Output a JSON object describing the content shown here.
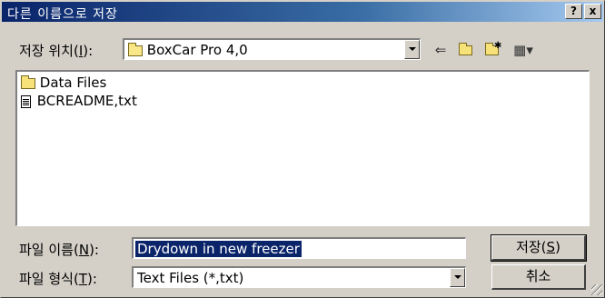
{
  "window": {
    "title": "다른 이름으로 저장",
    "help_label": "?",
    "close_label": "x"
  },
  "location": {
    "label": "저장 위치(",
    "accel": "I",
    "label_end": "):",
    "value": "BoxCar Pro 4,0"
  },
  "toolbar": {
    "back_icon": "back-arrow-icon",
    "up_icon": "up-folder-icon",
    "new_folder_icon": "new-folder-icon",
    "view_menu_icon": "view-menu-icon"
  },
  "files": [
    {
      "name": "Data Files",
      "icon": "folder-icon"
    },
    {
      "name": "BCREADME,txt",
      "icon": "text-file-icon"
    }
  ],
  "filename": {
    "label": "파일 이름(",
    "accel": "N",
    "label_end": "):",
    "value": "Drydown in new freezer"
  },
  "filetype": {
    "label": "파일 형식(",
    "accel": "T",
    "label_end": "):",
    "value": "Text Files (*,txt)"
  },
  "buttons": {
    "save": "저장(",
    "save_accel": "S",
    "save_end": ")",
    "cancel": "취소"
  }
}
